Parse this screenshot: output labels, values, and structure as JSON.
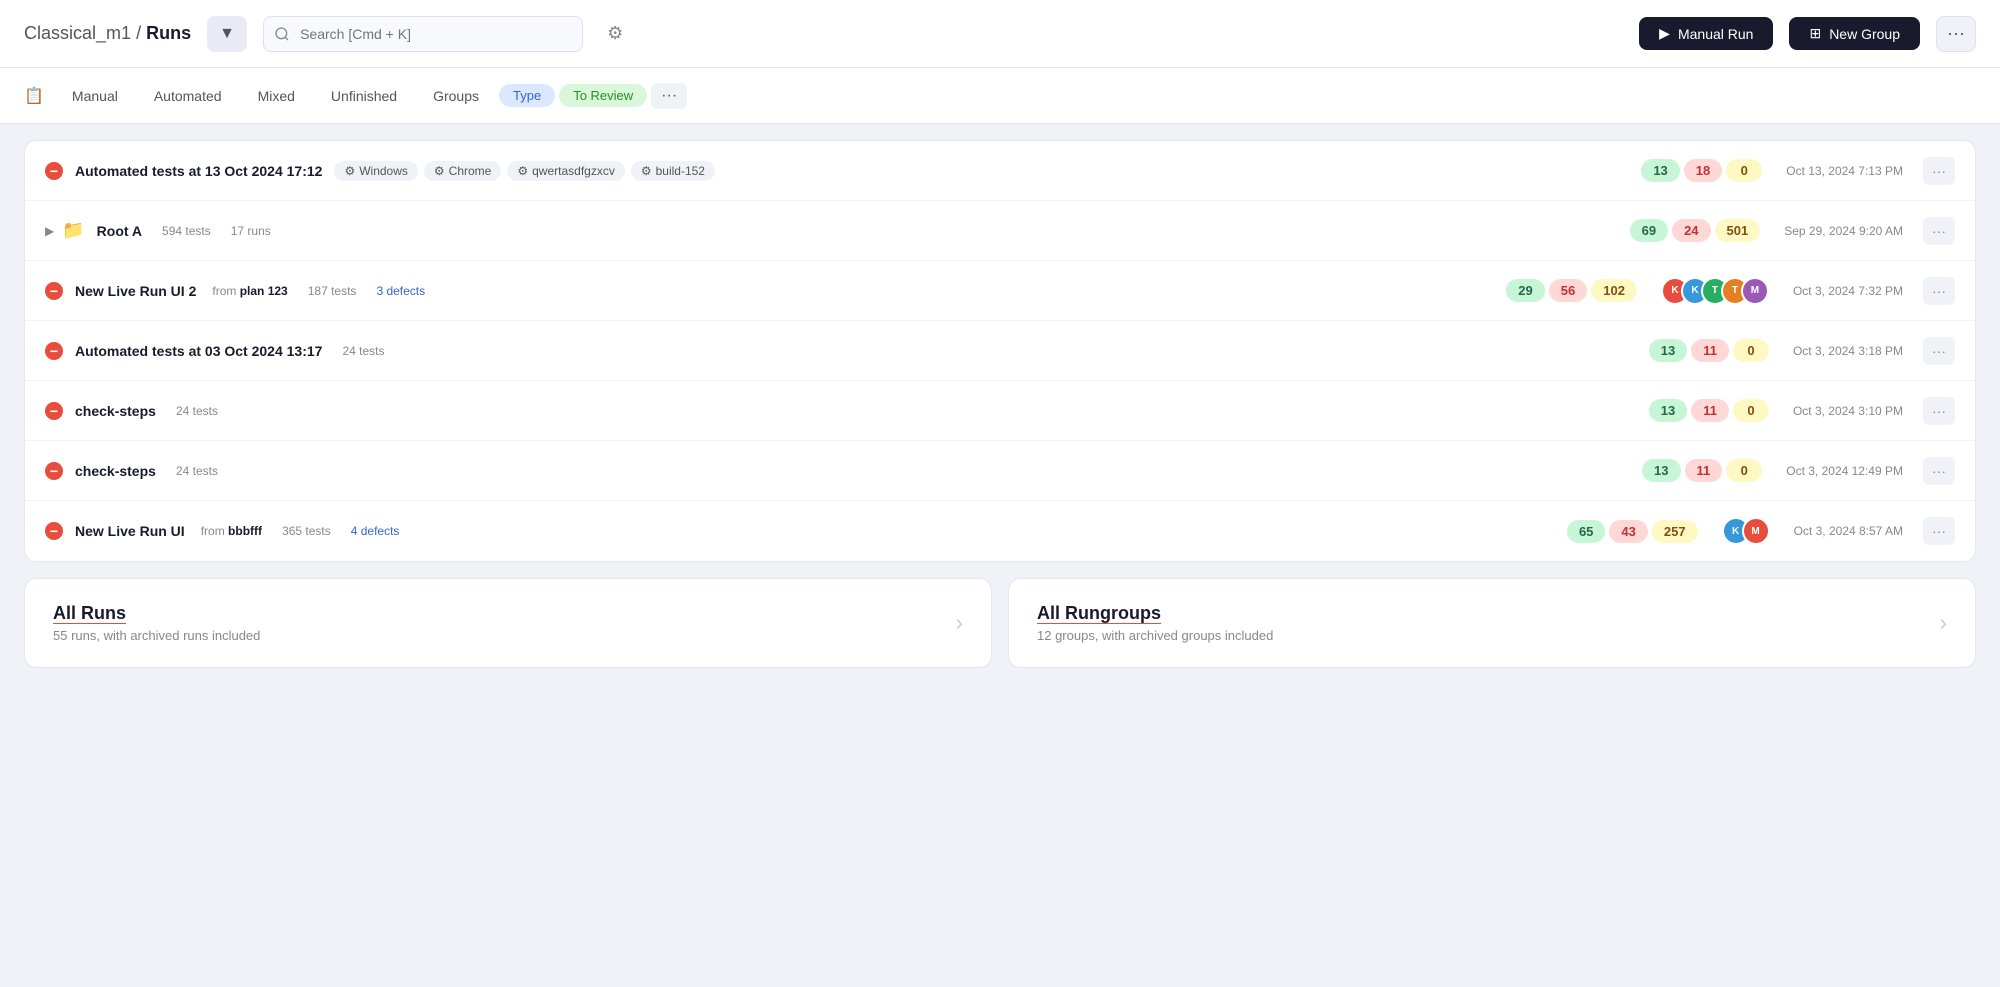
{
  "header": {
    "breadcrumb_project": "Classical_m1",
    "breadcrumb_sep": " / ",
    "breadcrumb_page": "Runs",
    "search_placeholder": "Search [Cmd + K]",
    "manual_run_label": "Manual Run",
    "new_group_label": "New Group"
  },
  "tabs": {
    "icon": "📋",
    "items": [
      {
        "label": "Manual",
        "active": false
      },
      {
        "label": "Automated",
        "active": false
      },
      {
        "label": "Mixed",
        "active": false
      },
      {
        "label": "Unfinished",
        "active": false
      },
      {
        "label": "Groups",
        "active": false
      }
    ],
    "type_label": "Type",
    "review_label": "To Review",
    "more_label": "···"
  },
  "runs": [
    {
      "id": "run-1",
      "status": "fail",
      "name": "Automated tests at 13 Oct 2024 17:12",
      "from_text": "",
      "from_bold": "",
      "meta_tests": "",
      "meta_defects": "",
      "tags": [
        {
          "label": "Windows"
        },
        {
          "label": "Chrome"
        },
        {
          "label": "qwertasdfgzxcv"
        },
        {
          "label": "build-152"
        }
      ],
      "count_green": "13",
      "count_red": "18",
      "count_yellow": "0",
      "avatars": [],
      "date": "Oct 13, 2024 7:13 PM"
    },
    {
      "id": "run-folder",
      "status": "folder",
      "name": "Root A",
      "from_text": "",
      "from_bold": "",
      "meta_tests": "594 tests",
      "meta_runs": "17 runs",
      "tags": [],
      "count_green": "69",
      "count_red": "24",
      "count_yellow": "501",
      "avatars": [],
      "date": "Sep 29, 2024 9:20 AM"
    },
    {
      "id": "run-3",
      "status": "fail",
      "name": "New Live Run UI 2",
      "from_text": "from ",
      "from_bold": "plan 123",
      "meta_tests": "187 tests",
      "meta_defects": "3 defects",
      "tags": [],
      "count_green": "29",
      "count_red": "56",
      "count_yellow": "102",
      "avatars": [
        {
          "color": "avatar-red",
          "label": "K"
        },
        {
          "color": "avatar-blue",
          "label": "K"
        },
        {
          "color": "avatar-green",
          "label": "T"
        },
        {
          "color": "avatar-orange",
          "label": "T"
        },
        {
          "color": "avatar-purple",
          "label": "M"
        }
      ],
      "date": "Oct 3, 2024 7:32 PM"
    },
    {
      "id": "run-4",
      "status": "fail",
      "name": "Automated tests at 03 Oct 2024 13:17",
      "from_text": "",
      "from_bold": "",
      "meta_tests": "24 tests",
      "meta_defects": "",
      "tags": [],
      "count_green": "13",
      "count_red": "11",
      "count_yellow": "0",
      "avatars": [],
      "date": "Oct 3, 2024 3:18 PM"
    },
    {
      "id": "run-5",
      "status": "fail",
      "name": "check-steps",
      "from_text": "",
      "from_bold": "",
      "meta_tests": "24 tests",
      "meta_defects": "",
      "tags": [],
      "count_green": "13",
      "count_red": "11",
      "count_yellow": "0",
      "avatars": [],
      "date": "Oct 3, 2024 3:10 PM"
    },
    {
      "id": "run-6",
      "status": "fail",
      "name": "check-steps",
      "from_text": "",
      "from_bold": "",
      "meta_tests": "24 tests",
      "meta_defects": "",
      "tags": [],
      "count_green": "13",
      "count_red": "11",
      "count_yellow": "0",
      "avatars": [],
      "date": "Oct 3, 2024 12:49 PM"
    },
    {
      "id": "run-7",
      "status": "fail",
      "name": "New Live Run UI",
      "from_text": "from ",
      "from_bold": "bbbfff",
      "meta_tests": "365 tests",
      "meta_defects": "4 defects",
      "tags": [],
      "count_green": "65",
      "count_red": "43",
      "count_yellow": "257",
      "avatars": [
        {
          "color": "avatar-blue",
          "label": "K"
        },
        {
          "color": "avatar-red",
          "label": "M"
        }
      ],
      "date": "Oct 3, 2024 8:57 AM"
    }
  ],
  "bottom": {
    "all_runs_title": "All Runs",
    "all_runs_sub": "55 runs, with archived runs included",
    "all_rungroups_title": "All Rungroups",
    "all_rungroups_sub": "12 groups, with archived groups included"
  }
}
